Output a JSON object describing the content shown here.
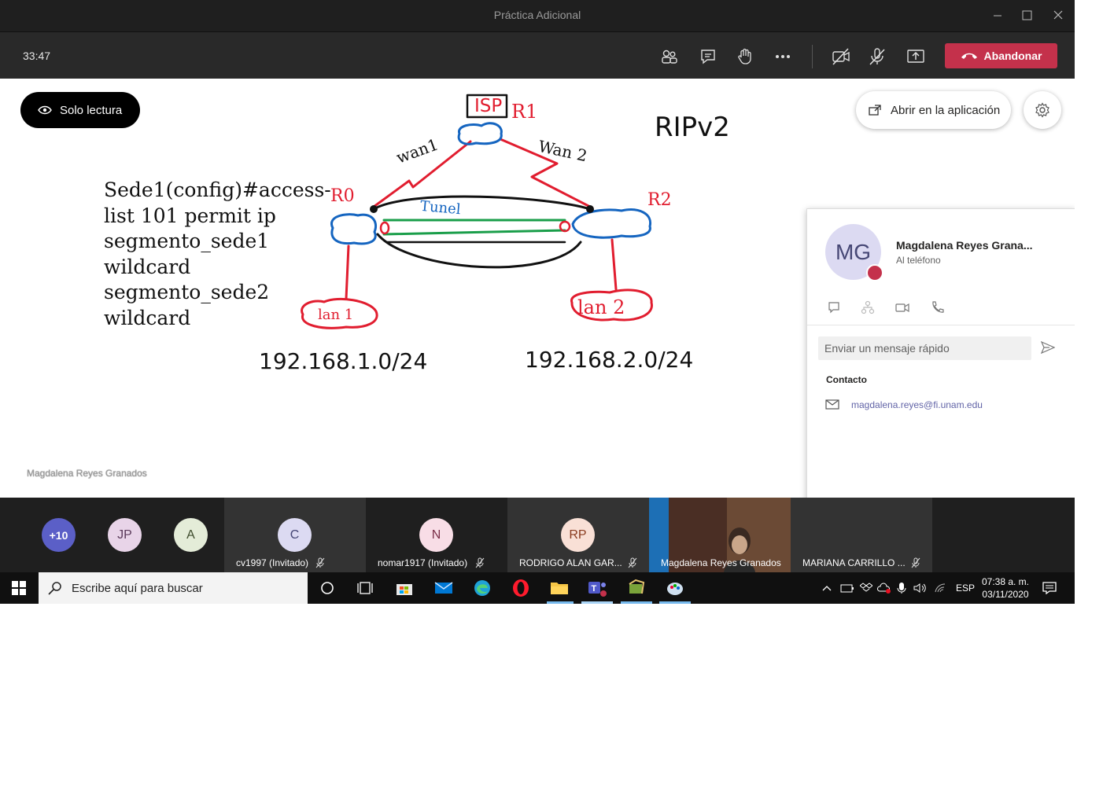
{
  "window": {
    "title": "Práctica Adicional"
  },
  "toolbar": {
    "timer": "33:47",
    "leave_label": "Abandonar"
  },
  "stage": {
    "readonly_label": "Solo lectura",
    "open_app_label": "Abrir en la aplicación",
    "presenter_name": "Magdalena Reyes Granados",
    "whiteboard": {
      "isp": "ISP",
      "r1": "R1",
      "rip": "RIPv2",
      "wan1": "wan1",
      "wan2": "Wan 2",
      "r0": "R0",
      "r2": "R2",
      "tunel": "Tunel",
      "lan1": "lan 1",
      "lan2": "lan 2",
      "net1": "192.168.1.0/24",
      "net2": "192.168.2.0/24",
      "acl": [
        "Sede1(config)#access-",
        "list 101 permit ip",
        "segmento_sede1",
        "wildcard",
        "segmento_sede2",
        "wildcard"
      ]
    }
  },
  "contact_card": {
    "initials": "MG",
    "name": "Magdalena Reyes Grana...",
    "status": "Al teléfono",
    "message_placeholder": "Enviar un mensaje rápido",
    "contact_heading": "Contacto",
    "email": "magdalena.reyes@fi.unam.edu"
  },
  "participants": {
    "overflow": "+10",
    "avatars": [
      {
        "initials": "JP",
        "bg": "#e8d4e8",
        "fg": "#5a3a5a"
      },
      {
        "initials": "A",
        "bg": "#e4ecd8",
        "fg": "#3d4b2c"
      },
      {
        "initials": "C",
        "bg": "#dcdaf2",
        "fg": "#464775"
      },
      {
        "initials": "N",
        "bg": "#f8dde6",
        "fg": "#7a2f48"
      },
      {
        "initials": "RP",
        "bg": "#f9e0d6",
        "fg": "#8a3c20"
      }
    ],
    "names": [
      "cv1997 (Invitado)",
      "nomar1917 (Invitado)",
      "RODRIGO ALAN GAR...",
      "Magdalena Reyes Granados",
      "MARIANA CARRILLO ..."
    ]
  },
  "taskbar": {
    "search_placeholder": "Escribe aquí para buscar",
    "lang": "ESP",
    "time": "07:38 a. m.",
    "date": "03/11/2020"
  },
  "colors": {
    "accent": "#6264a7",
    "leave": "#c4314b",
    "ink_red": "#e11d2f",
    "ink_blue": "#1565c0",
    "ink_green": "#1a9e4a"
  }
}
